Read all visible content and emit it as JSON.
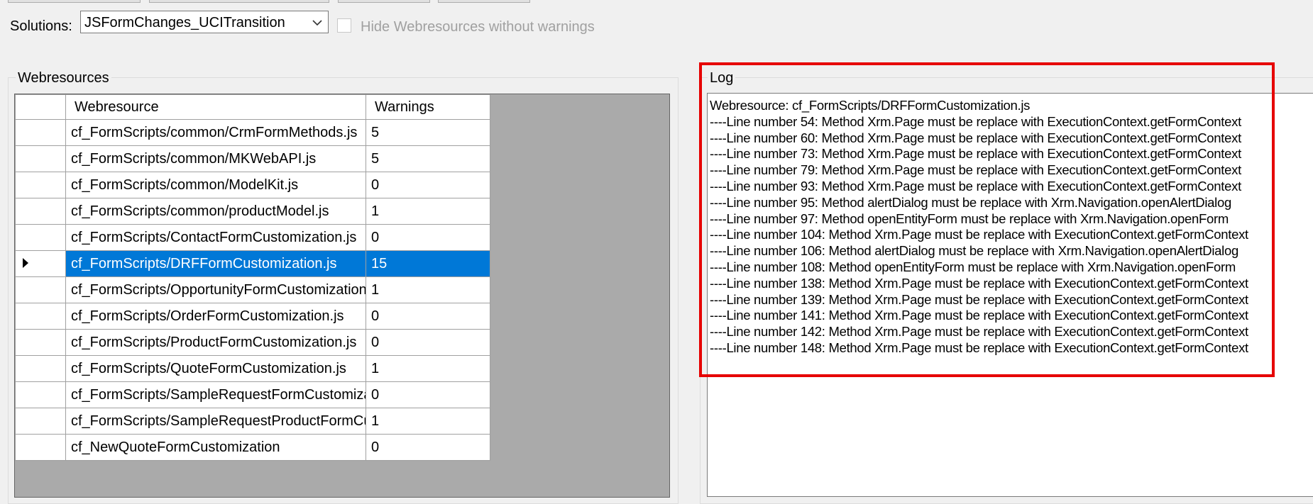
{
  "solutions_label": "Solutions:",
  "solution_selected": "JSFormChanges_UCITransition",
  "hide_checkbox_label": "Hide Webresources without warnings",
  "webresources_group_title": "Webresources",
  "log_group_title": "Log",
  "grid": {
    "columns": [
      "Webresource",
      "Warnings"
    ],
    "rows": [
      {
        "name": "cf_FormScripts/common/CrmFormMethods.js",
        "warnings": "5"
      },
      {
        "name": "cf_FormScripts/common/MKWebAPI.js",
        "warnings": "5"
      },
      {
        "name": "cf_FormScripts/common/ModelKit.js",
        "warnings": "0"
      },
      {
        "name": "cf_FormScripts/common/productModel.js",
        "warnings": "1"
      },
      {
        "name": "cf_FormScripts/ContactFormCustomization.js",
        "warnings": "0"
      },
      {
        "name": "cf_FormScripts/DRFFormCustomization.js",
        "warnings": "15"
      },
      {
        "name": "cf_FormScripts/OpportunityFormCustomization.js",
        "warnings": "1"
      },
      {
        "name": "cf_FormScripts/OrderFormCustomization.js",
        "warnings": "0"
      },
      {
        "name": "cf_FormScripts/ProductFormCustomization.js",
        "warnings": "0"
      },
      {
        "name": "cf_FormScripts/QuoteFormCustomization.js",
        "warnings": "1"
      },
      {
        "name": "cf_FormScripts/SampleRequestFormCustomizat...",
        "warnings": "0"
      },
      {
        "name": "cf_FormScripts/SampleRequestProductFormCu...",
        "warnings": "1"
      },
      {
        "name": "cf_NewQuoteFormCustomization",
        "warnings": "0"
      }
    ],
    "selected_index": 5
  },
  "log_lines": [
    "Webresource: cf_FormScripts/DRFFormCustomization.js",
    "----Line number 54: Method Xrm.Page must be replace with ExecutionContext.getFormContext",
    "----Line number 60: Method Xrm.Page must be replace with ExecutionContext.getFormContext",
    "----Line number 73: Method Xrm.Page must be replace with ExecutionContext.getFormContext",
    "----Line number 79: Method Xrm.Page must be replace with ExecutionContext.getFormContext",
    "----Line number 93: Method Xrm.Page must be replace with ExecutionContext.getFormContext",
    "----Line number 95: Method alertDialog must be replace with Xrm.Navigation.openAlertDialog",
    "----Line number 97: Method openEntityForm must be replace with Xrm.Navigation.openForm",
    "----Line number 104: Method Xrm.Page must be replace with ExecutionContext.getFormContext",
    "----Line number 106: Method alertDialog must be replace with Xrm.Navigation.openAlertDialog",
    "----Line number 108: Method openEntityForm must be replace with Xrm.Navigation.openForm",
    "----Line number 138: Method Xrm.Page must be replace with ExecutionContext.getFormContext",
    "----Line number 139: Method Xrm.Page must be replace with ExecutionContext.getFormContext",
    "----Line number 141: Method Xrm.Page must be replace with ExecutionContext.getFormContext",
    "----Line number 142: Method Xrm.Page must be replace with ExecutionContext.getFormContext",
    "----Line number 148: Method Xrm.Page must be replace with ExecutionContext.getFormContext"
  ],
  "colors": {
    "selection": "#0078d7",
    "highlight": "#e60000",
    "grid_background": "#aaaaaa"
  }
}
